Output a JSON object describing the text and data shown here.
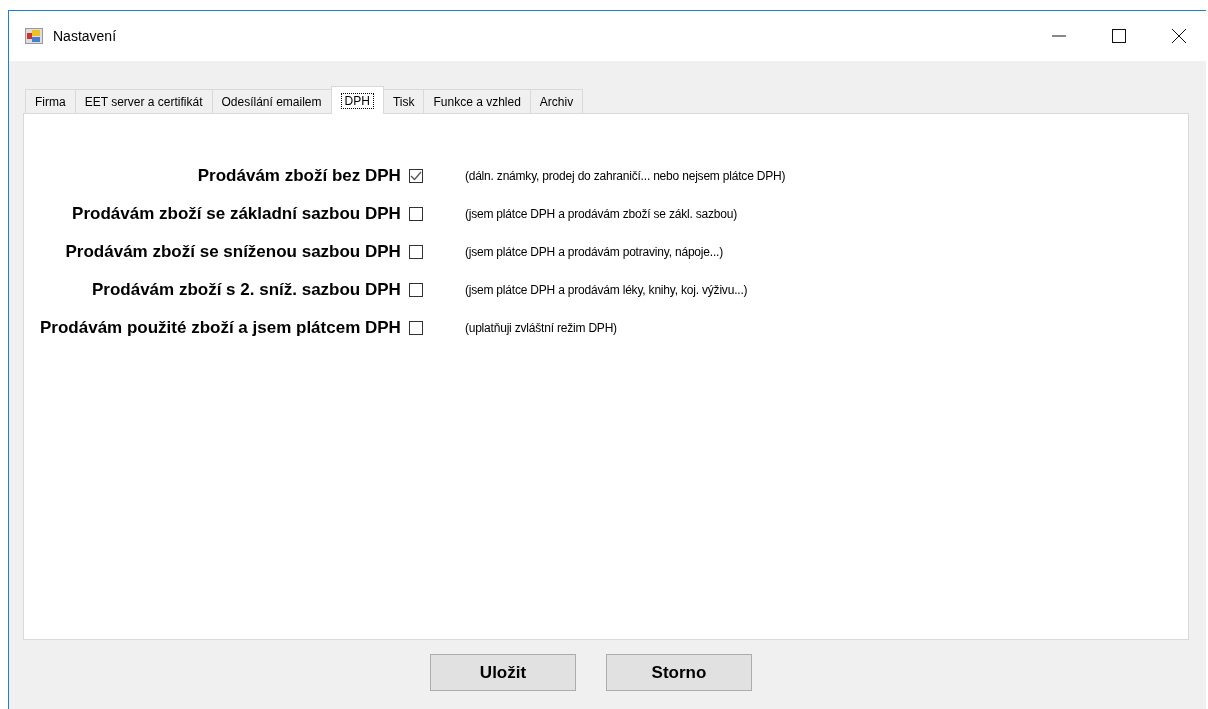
{
  "window": {
    "title": "Nastavení"
  },
  "tabs": [
    {
      "label": "Firma",
      "selected": false
    },
    {
      "label": "EET server a certifikát",
      "selected": false
    },
    {
      "label": "Odesílání emailem",
      "selected": false
    },
    {
      "label": "DPH",
      "selected": true
    },
    {
      "label": "Tisk",
      "selected": false
    },
    {
      "label": "Funkce a vzhled",
      "selected": false
    },
    {
      "label": "Archiv",
      "selected": false
    }
  ],
  "options": [
    {
      "label": "Prodávám zboží bez DPH",
      "checked": true,
      "note": "(dáln. známky, prodej do zahraničí... nebo nejsem plátce DPH)"
    },
    {
      "label": "Prodávám zboží se základní sazbou DPH",
      "checked": false,
      "note": "(jsem plátce DPH a prodávám zboží se zákl. sazbou)"
    },
    {
      "label": "Prodávám zboží se sníženou sazbou DPH",
      "checked": false,
      "note": "(jsem plátce DPH a prodávám potraviny, nápoje...)"
    },
    {
      "label": "Prodávám zboží s 2. sníž. sazbou DPH",
      "checked": false,
      "note": "(jsem plátce DPH a prodávám léky, knihy, koj. výživu...)"
    },
    {
      "label": "Prodávám použité zboží a jsem plátcem DPH",
      "checked": false,
      "note": "(uplatňuji zvláštní režim DPH)"
    }
  ],
  "buttons": [
    "Uložit",
    "Storno"
  ]
}
